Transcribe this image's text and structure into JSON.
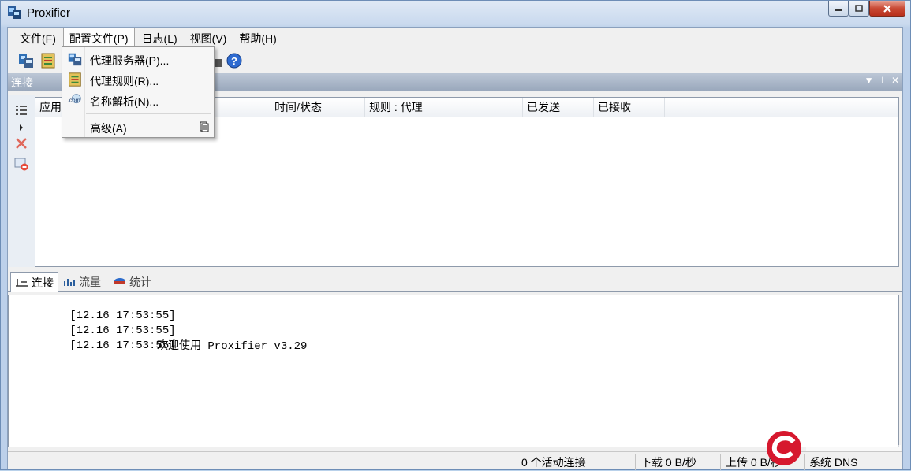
{
  "window": {
    "title": "Proxifier"
  },
  "menubar": [
    {
      "label": "文件(F)"
    },
    {
      "label": "配置文件(P)"
    },
    {
      "label": "日志(L)"
    },
    {
      "label": "视图(V)"
    },
    {
      "label": "帮助(H)"
    }
  ],
  "dropdown": {
    "items": [
      {
        "label": "代理服务器(P)...",
        "icon": "proxy-servers-icon"
      },
      {
        "label": "代理规则(R)...",
        "icon": "proxy-rules-icon"
      },
      {
        "label": "名称解析(N)...",
        "icon": "name-resolution-icon"
      },
      {
        "label": "高级(A)",
        "icon": "advanced-icon"
      }
    ]
  },
  "panel": {
    "title": "连接"
  },
  "grid": {
    "columns": [
      {
        "label": "应用"
      },
      {
        "label": "时间/状态"
      },
      {
        "label": "规则 : 代理"
      },
      {
        "label": "已发送"
      },
      {
        "label": "已接收"
      }
    ]
  },
  "tabs": [
    {
      "label": "连接"
    },
    {
      "label": "流量"
    },
    {
      "label": "统计"
    }
  ],
  "log": [
    {
      "time": "[12.16 17:53:55]",
      "message": ""
    },
    {
      "time": "[12.16 17:53:55]",
      "message": "欢迎使用 Proxifier v3.29"
    },
    {
      "time": "[12.16 17:53:55]",
      "message": ""
    }
  ],
  "status": {
    "active": "0 个活动连接",
    "download": "下载 0 B/秒",
    "upload": "上传 0 B/秒",
    "dns": "系统 DNS"
  },
  "colors": {
    "accent": "#3a6ea5",
    "panel_header": "#a9b6c8",
    "close": "#c94a35"
  }
}
